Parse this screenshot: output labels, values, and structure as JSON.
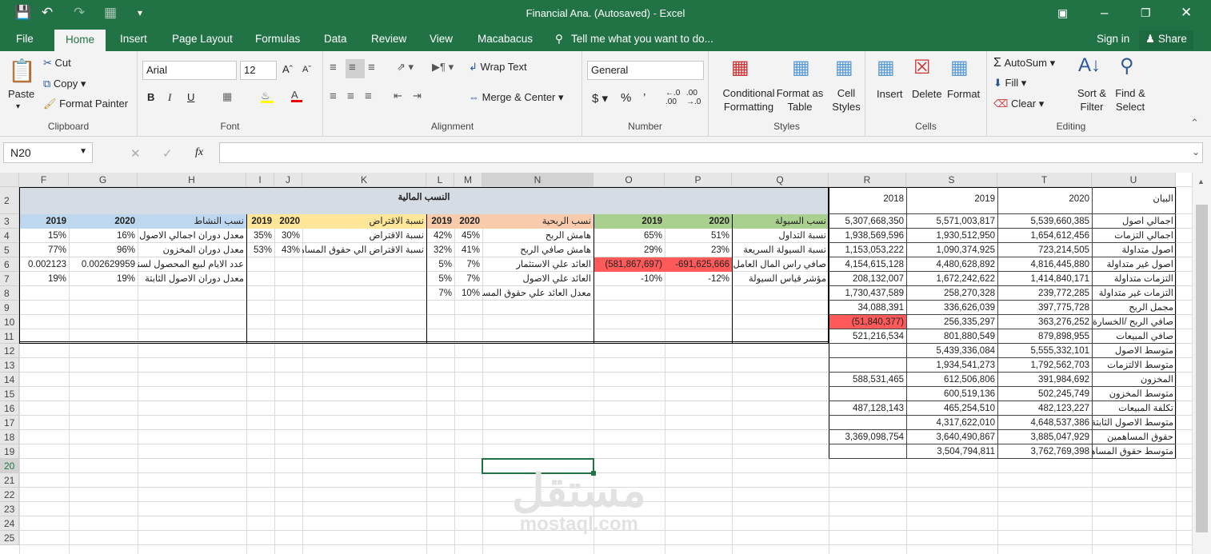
{
  "window": {
    "title": "Financial Ana. (Autosaved) - Excel"
  },
  "tabs": [
    {
      "label": "File"
    },
    {
      "label": "Home"
    },
    {
      "label": "Insert"
    },
    {
      "label": "Page Layout"
    },
    {
      "label": "Formulas"
    },
    {
      "label": "Data"
    },
    {
      "label": "Review"
    },
    {
      "label": "View"
    },
    {
      "label": "Macabacus"
    }
  ],
  "tell_me": "Tell me what you want to do...",
  "sign_in": "Sign in",
  "share": "Share",
  "ribbon": {
    "clipboard": {
      "label": "Clipboard",
      "paste": "Paste",
      "cut": "Cut",
      "copy": "Copy",
      "format_painter": "Format Painter"
    },
    "font": {
      "label": "Font",
      "name": "Arial",
      "size": "12",
      "bold": "B",
      "italic": "I",
      "underline": "U"
    },
    "alignment": {
      "label": "Alignment",
      "wrap": "Wrap Text",
      "merge": "Merge & Center"
    },
    "number": {
      "label": "Number",
      "format": "General"
    },
    "styles": {
      "label": "Styles",
      "conditional": "Conditional Formatting",
      "format_table": "Format as Table",
      "cell_styles": "Cell Styles"
    },
    "cells": {
      "label": "Cells",
      "insert": "Insert",
      "delete": "Delete",
      "format": "Format"
    },
    "editing": {
      "label": "Editing",
      "autosum": "AutoSum",
      "fill": "Fill",
      "clear": "Clear",
      "sort": "Sort & Filter",
      "find": "Find & Select"
    }
  },
  "formula_bar": {
    "name_box": "N20",
    "fx": "fx",
    "content": ""
  },
  "columns": [
    "F",
    "G",
    "H",
    "I",
    "J",
    "K",
    "L",
    "M",
    "N",
    "O",
    "P",
    "Q",
    "R",
    "S",
    "T",
    "U"
  ],
  "rows": [
    "2",
    "3",
    "4",
    "5",
    "6",
    "7",
    "8",
    "9",
    "10",
    "11",
    "12",
    "13",
    "14",
    "15",
    "16",
    "17",
    "18",
    "19",
    "20",
    "21",
    "22",
    "23",
    "24",
    "25"
  ],
  "sheet": {
    "title": "النسب المالية",
    "activity": {
      "year1": "2019",
      "year2": "2020",
      "header": "نسب النشاط",
      "rows": [
        {
          "y1": "15%",
          "y2": "16%",
          "label": "معدل دوران اجمالي الاصول"
        },
        {
          "y1": "77%",
          "y2": "96%",
          "label": "معدل دوران المخزون"
        },
        {
          "y1": "0.002123",
          "y2": "0.002629959",
          "label": "عدد الايام لبيع المحصول لسنة"
        },
        {
          "y1": "19%",
          "y2": "19%",
          "label": "معدل دوران الاصول الثابتة"
        }
      ]
    },
    "leverage": {
      "year1": "2019",
      "year2": "2020",
      "header": "نسبة الاقتراض",
      "rows": [
        {
          "y1": "35%",
          "y2": "30%",
          "label": "نسبة الاقتراض"
        },
        {
          "y1": "53%",
          "y2": "43%",
          "label": "نسبة الاقتراض الي حقوق المساهمين"
        }
      ]
    },
    "profit": {
      "year1": "2019",
      "year2": "2020",
      "header": "نسب الربحية",
      "rows": [
        {
          "y1": "42%",
          "y2": "45%",
          "label": "هامش الربح"
        },
        {
          "y1": "32%",
          "y2": "41%",
          "label": "هامش صافي الربح"
        },
        {
          "y1": "5%",
          "y2": "7%",
          "label": "العائد علي الاستثمار"
        },
        {
          "y1": "5%",
          "y2": "7%",
          "label": "العائد علي الاصول"
        },
        {
          "y1": "7%",
          "y2": "10%",
          "label": "معدل العائد علي حقوق المساهمين"
        }
      ]
    },
    "liquidity": {
      "year1": "2019",
      "year2": "2020",
      "header": "نسب السيولة",
      "rows": [
        {
          "y1": "65%",
          "y2": "51%",
          "label": "نسبة التداول"
        },
        {
          "y1": "29%",
          "y2": "23%",
          "label": "نسبة السيولة السريعة"
        },
        {
          "y1": "(581,867,697)",
          "y2": "-691,625,666",
          "label": "صافي راس المال العامل"
        },
        {
          "y1": "-10%",
          "y2": "-12%",
          "label": "مؤشر قياس السيولة"
        }
      ]
    },
    "data": {
      "h2018": "2018",
      "h2019": "2019",
      "h2020": "2020",
      "hlabel": "البيان",
      "rows": [
        {
          "a": "5,307,668,350",
          "b": "5,571,003,817",
          "c": "5,539,660,385",
          "label": "اجمالي اصول"
        },
        {
          "a": "1,938,569,596",
          "b": "1,930,512,950",
          "c": "1,654,612,456",
          "label": "اجمالي التزمات"
        },
        {
          "a": "1,153,053,222",
          "b": "1,090,374,925",
          "c": "723,214,505",
          "label": "اصول متداولة"
        },
        {
          "a": "4,154,615,128",
          "b": "4,480,628,892",
          "c": "4,816,445,880",
          "label": "اصول غير متداولة"
        },
        {
          "a": "208,132,007",
          "b": "1,672,242,622",
          "c": "1,414,840,171",
          "label": "التزمات متداولة"
        },
        {
          "a": "1,730,437,589",
          "b": "258,270,328",
          "c": "239,772,285",
          "label": "التزمات غير متداولة"
        },
        {
          "a": "34,088,391",
          "b": "336,626,039",
          "c": "397,775,728",
          "label": "مجمل الربح"
        },
        {
          "a": "(51,840,377)",
          "b": "256,335,297",
          "c": "363,276,252",
          "label": "صافي الربح /الخسارة"
        },
        {
          "a": "521,216,534",
          "b": "801,880,549",
          "c": "879,898,955",
          "label": "صافي المبيعات"
        },
        {
          "a": "",
          "b": "5,439,336,084",
          "c": "5,555,332,101",
          "label": "متوسط الاصول"
        },
        {
          "a": "",
          "b": "1,934,541,273",
          "c": "1,792,562,703",
          "label": "متوسط الالتزمات"
        },
        {
          "a": "588,531,465",
          "b": "612,506,806",
          "c": "391,984,692",
          "label": "المخزون"
        },
        {
          "a": "",
          "b": "600,519,136",
          "c": "502,245,749",
          "label": "متوسط المخزون"
        },
        {
          "a": "487,128,143",
          "b": "465,254,510",
          "c": "482,123,227",
          "label": "تكلفة المبيعات"
        },
        {
          "a": "",
          "b": "4,317,622,010",
          "c": "4,648,537,386",
          "label": "متوسط الاصول الثابتة"
        },
        {
          "a": "3,369,098,754",
          "b": "3,640,490,867",
          "c": "3,885,047,929",
          "label": "حقوق المساهمين"
        },
        {
          "a": "",
          "b": "3,504,794,811",
          "c": "3,762,769,398",
          "label": "متوسط حقوق المساهمين"
        }
      ]
    }
  },
  "watermark": {
    "arabic": "مستقل",
    "latin": "mostaql.com"
  },
  "colors": {
    "excel_green": "#217346",
    "header_blue": "#bdd7ee",
    "header_yellow": "#ffe699",
    "header_salmon": "#f8cbad",
    "header_green": "#a9d08e",
    "title_gray": "#d6dce4",
    "negative_red": "#ff5a5a"
  }
}
